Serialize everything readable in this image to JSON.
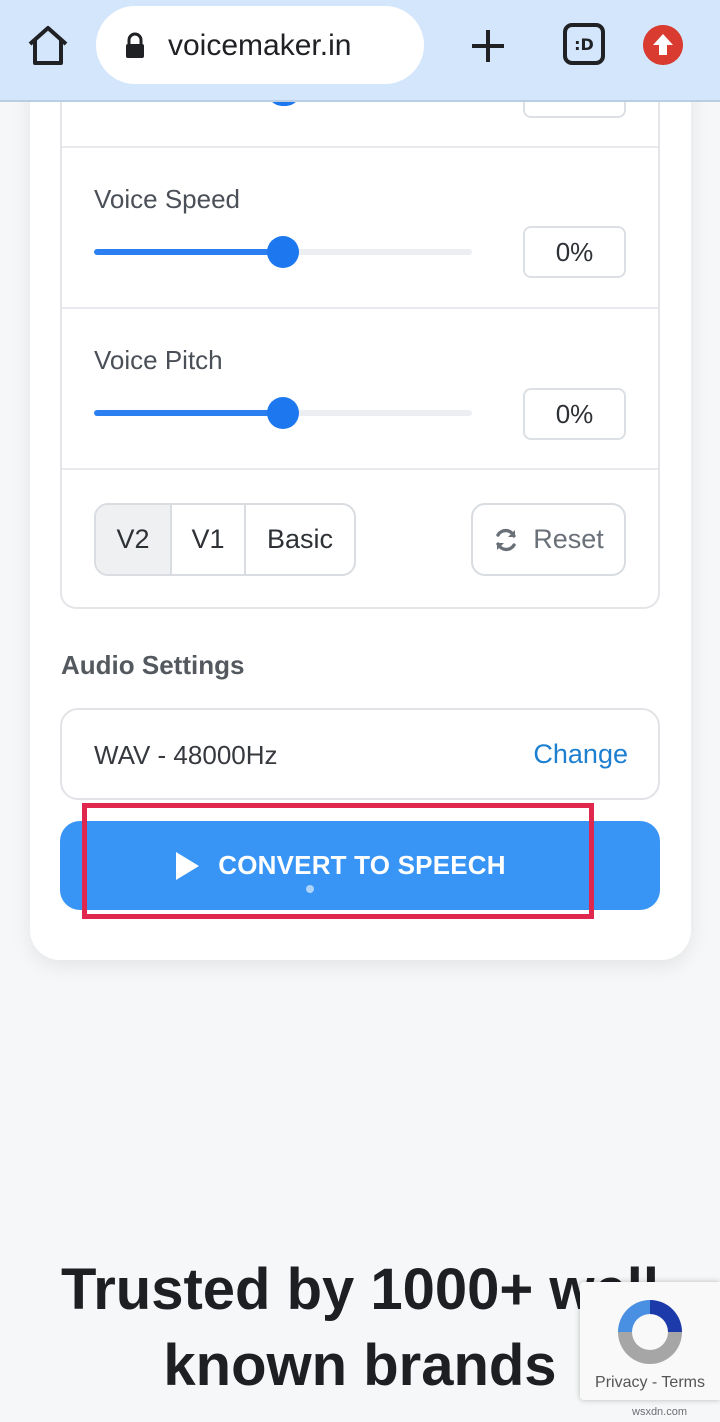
{
  "browser": {
    "url": "voicemaker.in",
    "tabs_label": ":D"
  },
  "voice_speed": {
    "label": "Voice Speed",
    "value": "0%",
    "slider_fraction": 0.5
  },
  "voice_pitch": {
    "label": "Voice Pitch",
    "value": "0%",
    "slider_fraction": 0.5
  },
  "engine_tabs": [
    "V2",
    "V1",
    "Basic"
  ],
  "engine_selected": "V2",
  "reset_label": "Reset",
  "audio_settings": {
    "title": "Audio Settings",
    "format": "WAV - 48000Hz",
    "change_label": "Change"
  },
  "convert_label": "CONVERT TO SPEECH",
  "trusted": {
    "line1": "Trusted by 1000+ well",
    "line2": "known brands"
  },
  "recaptcha": {
    "links": "Privacy - Terms"
  },
  "watermark": "wsxdn.com",
  "colors": {
    "accent": "#3894f5",
    "slider": "#1d78f0",
    "highlight": "#e0284f",
    "link": "#1d7fd0"
  }
}
